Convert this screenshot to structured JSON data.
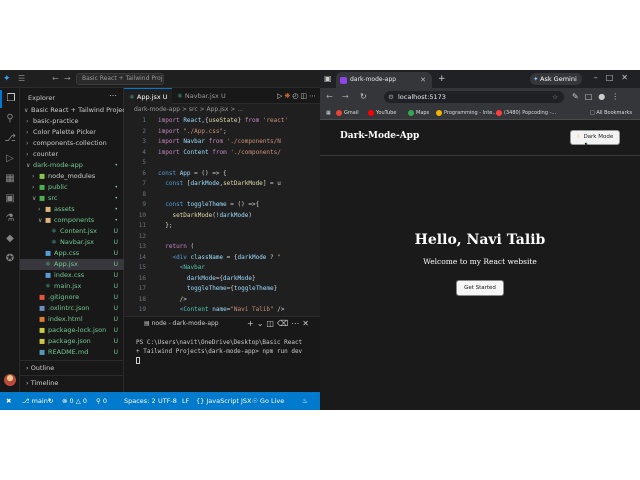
{
  "vscode": {
    "search_text": "Basic React + Tailwind Projects",
    "explorer": {
      "title": "Explorer",
      "root": "Basic React + Tailwind Projects",
      "items": [
        {
          "label": "basic-practice",
          "type": "folder",
          "expanded": false
        },
        {
          "label": "Color Palette Picker",
          "type": "folder",
          "expanded": false
        },
        {
          "label": "components-collection",
          "type": "folder",
          "expanded": false
        },
        {
          "label": "counter",
          "type": "folder",
          "expanded": false
        },
        {
          "label": "dark-mode-app",
          "type": "folder",
          "expanded": true,
          "badge": "•"
        },
        {
          "label": "node_modules",
          "type": "folder",
          "expanded": false
        },
        {
          "label": "public",
          "type": "folder",
          "expanded": false,
          "badge": "•"
        },
        {
          "label": "src",
          "type": "folder",
          "expanded": true,
          "badge": "•"
        },
        {
          "label": "assets",
          "type": "folder",
          "expanded": false,
          "badge": "•"
        },
        {
          "label": "components",
          "type": "folder",
          "expanded": true,
          "badge": "•"
        },
        {
          "label": "Content.jsx",
          "type": "file",
          "badge": "U"
        },
        {
          "label": "Navbar.jsx",
          "type": "file",
          "badge": "U"
        },
        {
          "label": "App.css",
          "type": "file",
          "badge": "U"
        },
        {
          "label": "App.jsx",
          "type": "file",
          "badge": "U"
        },
        {
          "label": "index.css",
          "type": "file",
          "badge": "U"
        },
        {
          "label": "main.jsx",
          "type": "file",
          "badge": "U"
        },
        {
          "label": ".gitignore",
          "type": "file",
          "badge": "U"
        },
        {
          "label": ".oxlintrc.json",
          "type": "file",
          "badge": "U"
        },
        {
          "label": "index.html",
          "type": "file",
          "badge": "U"
        },
        {
          "label": "package-lock.json",
          "type": "file",
          "badge": "U"
        },
        {
          "label": "package.json",
          "type": "file",
          "badge": "U"
        },
        {
          "label": "README.md",
          "type": "file",
          "badge": "U"
        }
      ],
      "outline": "Outline",
      "timeline": "Timeline"
    },
    "tabs": [
      {
        "label": "App.jsx U"
      },
      {
        "label": "Navbar.jsx U"
      }
    ],
    "breadcrumb": "dark-mode-app > src > App.jsx > ...",
    "code_lines": [
      {
        "n": "1",
        "text": "import React,{useState} from 'react'"
      },
      {
        "n": "2",
        "text": "import \"./App.css\";"
      },
      {
        "n": "3",
        "text": "import Navbar from './components/N"
      },
      {
        "n": "4",
        "text": "import Content from './components/"
      },
      {
        "n": "5",
        "text": ""
      },
      {
        "n": "6",
        "text": "const App = () => {"
      },
      {
        "n": "7",
        "text": "  const [darkMode,setDarkMode] = u"
      },
      {
        "n": "8",
        "text": ""
      },
      {
        "n": "9",
        "text": "  const toggleTheme = () =>{"
      },
      {
        "n": "10",
        "text": "    setDarkMode(!darkMode)"
      },
      {
        "n": "11",
        "text": "  };"
      },
      {
        "n": "12",
        "text": ""
      },
      {
        "n": "13",
        "text": "  return ("
      },
      {
        "n": "14",
        "text": "    <div className = {darkMode ? \""
      },
      {
        "n": "15",
        "text": "      <Navbar"
      },
      {
        "n": "16",
        "text": "        darkMode={darkMode}"
      },
      {
        "n": "17",
        "text": "        toggleTheme={toggleTheme}"
      },
      {
        "n": "18",
        "text": "      />"
      },
      {
        "n": "19",
        "text": "      <Content name=\"Navi Talib\" />"
      }
    ],
    "terminal": {
      "tab": "node - dark-mode-app",
      "line1": "PS C:\\Users\\navit\\OneDrive\\Desktop\\Basic React",
      "line2": "+ Tailwind Projects\\dark-mode-app> npm run dev"
    },
    "status": {
      "branch": "main*",
      "errors": "0",
      "warnings": "0",
      "spaces": "Spaces: 2",
      "encoding": "UTF-8",
      "eol": "LF",
      "language": "JavaScript JSX",
      "go_live": "Go Live"
    }
  },
  "chrome": {
    "tab_title": "dark-mode-app",
    "ask_gemini": "Ask Gemini",
    "url": "localhost:5173",
    "bookmarks": [
      {
        "label": "Gmail",
        "color": "#ea4335"
      },
      {
        "label": "YouTube",
        "color": "#ff0000"
      },
      {
        "label": "Maps",
        "color": "#34a853"
      },
      {
        "label": "Programming - Inte...",
        "color": "#f4b400"
      },
      {
        "label": "(3480) Popcoding -...",
        "color": "#ff3d3d"
      }
    ],
    "all_bookmarks": "All Bookmarks"
  },
  "app": {
    "brand": "Dark-Mode-App",
    "toggle_label": "Dark Mode",
    "hero_title": "Hello, Navi Talib",
    "hero_subtitle": "Welcome to my React website",
    "cta_label": "Get Started"
  }
}
